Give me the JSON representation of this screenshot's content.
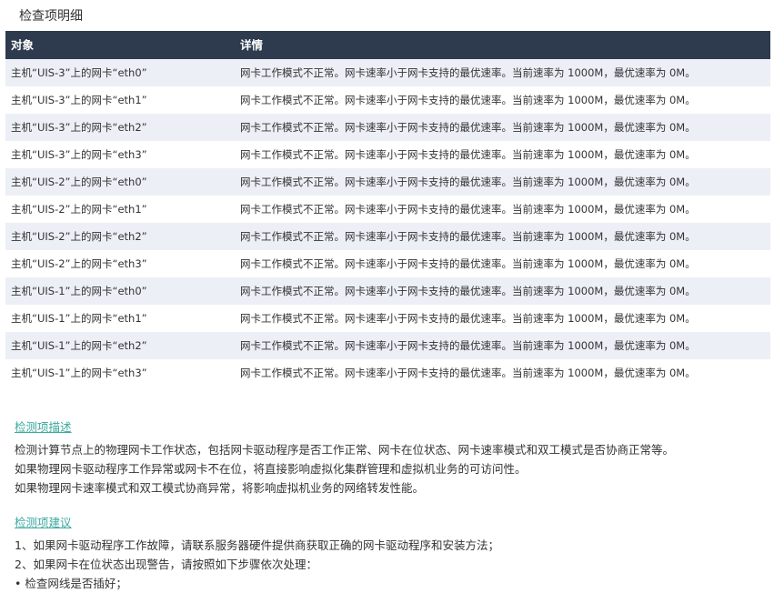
{
  "section_title": "检查项明细",
  "table": {
    "headers": [
      "对象",
      "详情"
    ],
    "rows": [
      {
        "object": "主机“UIS-3”上的网卡“eth0”",
        "detail": "网卡工作模式不正常。网卡速率小于网卡支持的最优速率。当前速率为 1000M，最优速率为 0M。"
      },
      {
        "object": "主机“UIS-3”上的网卡“eth1”",
        "detail": "网卡工作模式不正常。网卡速率小于网卡支持的最优速率。当前速率为 1000M，最优速率为 0M。"
      },
      {
        "object": "主机“UIS-3”上的网卡“eth2”",
        "detail": "网卡工作模式不正常。网卡速率小于网卡支持的最优速率。当前速率为 1000M，最优速率为 0M。"
      },
      {
        "object": "主机“UIS-3”上的网卡“eth3”",
        "detail": "网卡工作模式不正常。网卡速率小于网卡支持的最优速率。当前速率为 1000M，最优速率为 0M。"
      },
      {
        "object": "主机“UIS-2”上的网卡“eth0”",
        "detail": "网卡工作模式不正常。网卡速率小于网卡支持的最优速率。当前速率为 1000M，最优速率为 0M。"
      },
      {
        "object": "主机“UIS-2”上的网卡“eth1”",
        "detail": "网卡工作模式不正常。网卡速率小于网卡支持的最优速率。当前速率为 1000M，最优速率为 0M。"
      },
      {
        "object": "主机“UIS-2”上的网卡“eth2”",
        "detail": "网卡工作模式不正常。网卡速率小于网卡支持的最优速率。当前速率为 1000M，最优速率为 0M。"
      },
      {
        "object": "主机“UIS-2”上的网卡“eth3”",
        "detail": "网卡工作模式不正常。网卡速率小于网卡支持的最优速率。当前速率为 1000M，最优速率为 0M。"
      },
      {
        "object": "主机“UIS-1”上的网卡“eth0”",
        "detail": "网卡工作模式不正常。网卡速率小于网卡支持的最优速率。当前速率为 1000M，最优速率为 0M。"
      },
      {
        "object": "主机“UIS-1”上的网卡“eth1”",
        "detail": "网卡工作模式不正常。网卡速率小于网卡支持的最优速率。当前速率为 1000M，最优速率为 0M。"
      },
      {
        "object": "主机“UIS-1”上的网卡“eth2”",
        "detail": "网卡工作模式不正常。网卡速率小于网卡支持的最优速率。当前速率为 1000M，最优速率为 0M。"
      },
      {
        "object": "主机“UIS-1”上的网卡“eth3”",
        "detail": "网卡工作模式不正常。网卡速率小于网卡支持的最优速率。当前速率为 1000M，最优速率为 0M。"
      }
    ]
  },
  "description": {
    "heading": "检测项描述",
    "lines": [
      "检测计算节点上的物理网卡工作状态，包括网卡驱动程序是否工作正常、网卡在位状态、网卡速率模式和双工模式是否协商正常等。",
      "如果物理网卡驱动程序工作异常或网卡不在位，将直接影响虚拟化集群管理和虚拟机业务的可访问性。",
      "如果物理网卡速率模式和双工模式协商异常，将影响虚拟机业务的网络转发性能。"
    ]
  },
  "advice": {
    "heading": "检测项建议",
    "lines": [
      "1、如果网卡驱动程序工作故障，请联系服务器硬件提供商获取正确的网卡驱动程序和安装方法；",
      "2、如果网卡在位状态出现警告，请按照如下步骤依次处理：",
      "• 检查网线是否插好；"
    ]
  },
  "colors": {
    "header_bg": "#2e3b4e",
    "row_alt_bg": "#eceff6",
    "link": "#3aa99f"
  }
}
